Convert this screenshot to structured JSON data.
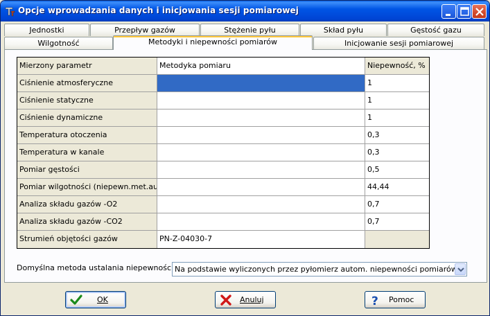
{
  "window": {
    "title": "Opcje wprowadzania danych i inicjowania sesji pomiarowej"
  },
  "tabs_row1": [
    {
      "label": "Jednostki"
    },
    {
      "label": "Przepływ gazów"
    },
    {
      "label": "Stężenie pyłu"
    },
    {
      "label": "Skład pyłu"
    },
    {
      "label": "Gęstość gazu"
    }
  ],
  "tabs_row2": [
    {
      "label": "Wilgotność"
    },
    {
      "label": "Metodyki i niepewności pomiarów",
      "active": true
    },
    {
      "label": "Inicjowanie sesji pomiarowej"
    }
  ],
  "table": {
    "headers": [
      "Mierzony parametr",
      "Metodyka pomiaru",
      "Niepewność, %"
    ],
    "rows": [
      {
        "param": "Ciśnienie atmosferyczne",
        "method": "",
        "uncertainty": "1"
      },
      {
        "param": "Ciśnienie statyczne",
        "method": "",
        "uncertainty": "1"
      },
      {
        "param": "Ciśnienie dynamiczne",
        "method": "",
        "uncertainty": "1"
      },
      {
        "param": "Temperatura otoczenia",
        "method": "",
        "uncertainty": "0,3"
      },
      {
        "param": "Temperatura w kanale",
        "method": "",
        "uncertainty": "0,3"
      },
      {
        "param": "Pomiar gęstości",
        "method": "",
        "uncertainty": "0,5"
      },
      {
        "param": "Pomiar wilgotności (niepewn.met.au",
        "method": "",
        "uncertainty": "44,44"
      },
      {
        "param": "Analiza składu gazów -O2",
        "method": "",
        "uncertainty": "0,7"
      },
      {
        "param": "Analiza składu gazów -CO2",
        "method": "",
        "uncertainty": "0,7"
      },
      {
        "param": "Strumień objętości gazów",
        "method": "PN-Z-04030-7",
        "uncertainty": ""
      }
    ]
  },
  "default_method": {
    "label": "Domyślna metoda ustalania niepewności",
    "value": "Na podstawie wyliczonych przez pyłomierz autom. niepewności pomiarów"
  },
  "buttons": {
    "ok": "OK",
    "cancel": "Anuluj",
    "help": "Pomoc"
  },
  "colors": {
    "titlebar": "#0055e5",
    "selection": "#316ac5",
    "active_tab_accent": "#ffc83c",
    "close_button": "#d24b2c"
  },
  "icons": [
    "app-icon",
    "minimize-icon",
    "maximize-icon",
    "close-icon",
    "checkmark-icon",
    "red-x-icon",
    "question-icon",
    "dropdown-arrow-icon"
  ]
}
